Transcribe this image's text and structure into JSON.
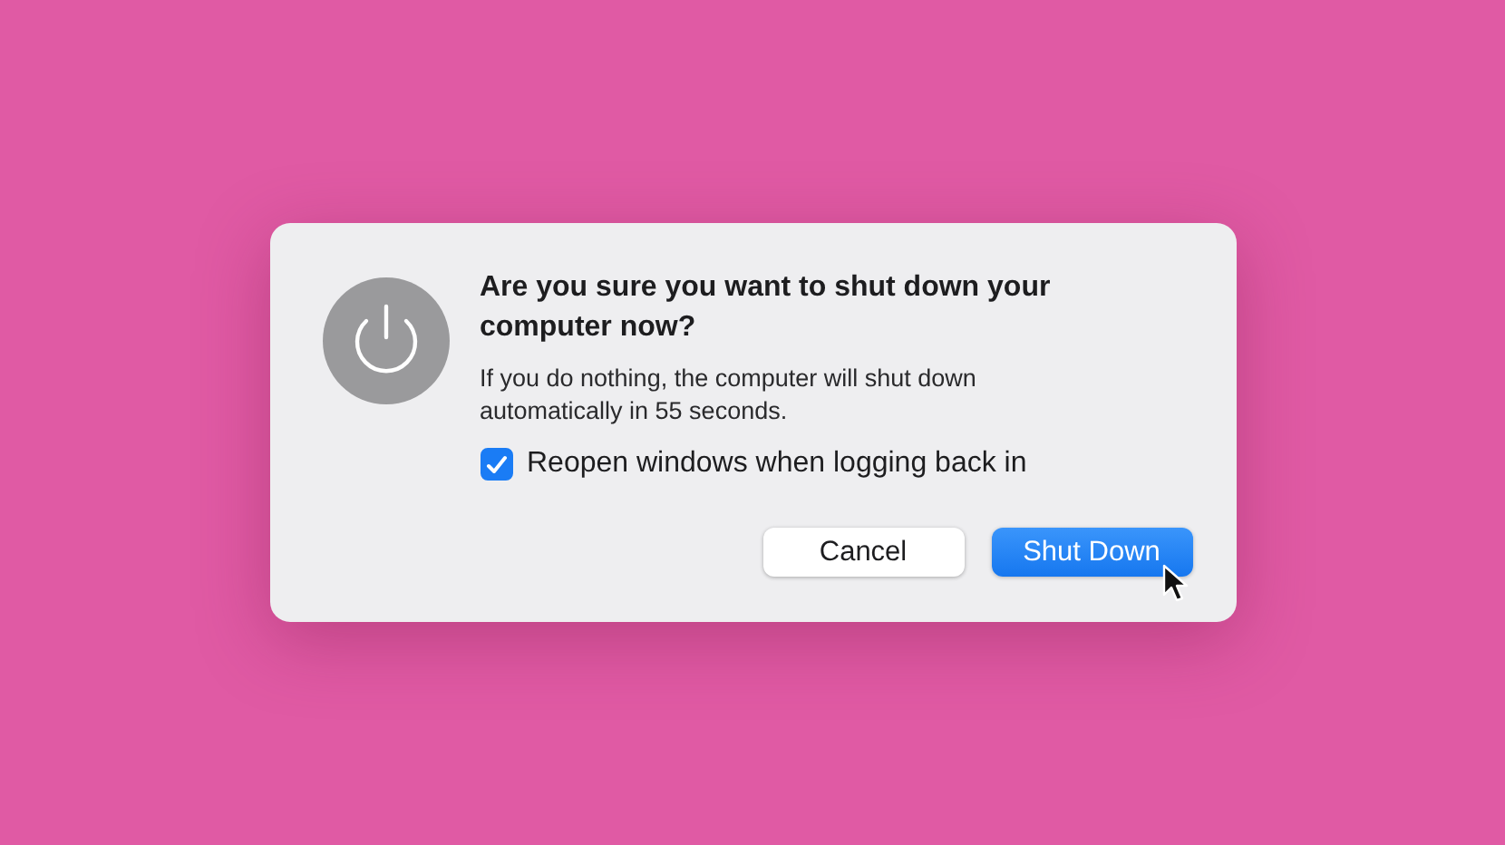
{
  "dialog": {
    "title": "Are you sure you want to shut down your computer now?",
    "message": "If you do nothing, the computer will shut down automatically in 55 seconds.",
    "checkbox": {
      "label": "Reopen windows when logging back in",
      "checked": true
    },
    "buttons": [
      {
        "label": "Cancel",
        "default": false
      },
      {
        "label": "Shut Down",
        "default": true
      }
    ]
  }
}
